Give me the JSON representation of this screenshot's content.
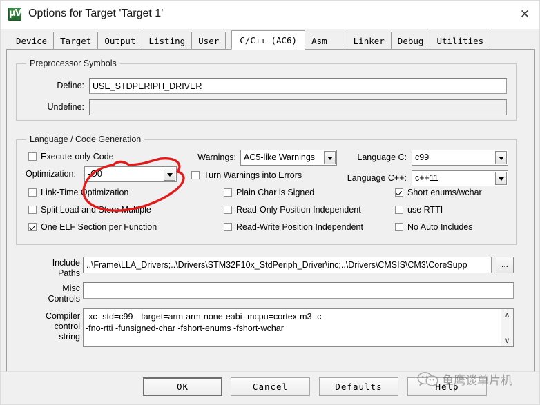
{
  "window": {
    "title": "Options for Target 'Target 1'",
    "app_icon": "keil-uvision-icon",
    "icon_glyph": "μV",
    "close_glyph": "✕"
  },
  "tabs": [
    {
      "label": "Device",
      "active": false
    },
    {
      "label": "Target",
      "active": false
    },
    {
      "label": "Output",
      "active": false
    },
    {
      "label": "Listing",
      "active": false
    },
    {
      "label": "User",
      "active": false
    },
    {
      "label": "C/C++ (AC6)",
      "active": true
    },
    {
      "label": "Asm",
      "active": false
    },
    {
      "label": "Linker",
      "active": false
    },
    {
      "label": "Debug",
      "active": false
    },
    {
      "label": "Utilities",
      "active": false
    }
  ],
  "preprocessor": {
    "title": "Preprocessor Symbols",
    "define_label": "Define:",
    "define_value": "USE_STDPERIPH_DRIVER",
    "undefine_label": "Undefine:",
    "undefine_value": ""
  },
  "language": {
    "title": "Language / Code Generation",
    "execute_only_code": {
      "label": "Execute-only Code",
      "checked": false
    },
    "optimization_label": "Optimization:",
    "optimization_value": "-O0",
    "link_time_optimization": {
      "label": "Link-Time Optimization",
      "checked": false
    },
    "split_load_store": {
      "label": "Split Load and Store Multiple",
      "checked": false
    },
    "one_elf_section": {
      "label": "One ELF Section per Function",
      "checked": true
    },
    "warnings_label": "Warnings:",
    "warnings_value": "AC5-like Warnings",
    "turn_warnings_into_errors": {
      "label": "Turn Warnings into Errors",
      "checked": false
    },
    "plain_char_signed": {
      "label": "Plain Char is Signed",
      "checked": false
    },
    "read_only_position_independent": {
      "label": "Read-Only Position Independent",
      "checked": false
    },
    "read_write_position_independent": {
      "label": "Read-Write Position Independent",
      "checked": false
    },
    "language_c_label": "Language C:",
    "language_c_value": "c99",
    "language_cpp_label": "Language C++:",
    "language_cpp_value": "c++11",
    "short_enums_wchar": {
      "label": "Short enums/wchar",
      "checked": true
    },
    "use_rtti": {
      "label": "use RTTI",
      "checked": false
    },
    "no_auto_includes": {
      "label": "No Auto Includes",
      "checked": false
    }
  },
  "paths": {
    "include_label_line1": "Include",
    "include_label_line2": "Paths",
    "include_value": "..\\Frame\\LLA_Drivers;..\\Drivers\\STM32F10x_StdPeriph_Driver\\inc;..\\Drivers\\CMSIS\\CM3\\CoreSupp",
    "browse_label": "...",
    "misc_label_line1": "Misc",
    "misc_label_line2": "Controls",
    "misc_value": "",
    "compiler_label_line1": "Compiler",
    "compiler_label_line2": "control",
    "compiler_label_line3": "string",
    "compiler_value_line1": "-xc -std=c99 --target=arm-arm-none-eabi -mcpu=cortex-m3 -c",
    "compiler_value_line2": "-fno-rtti -funsigned-char -fshort-enums -fshort-wchar",
    "scroll_up_glyph": "∧",
    "scroll_down_glyph": "∨"
  },
  "buttons": {
    "ok": "OK",
    "cancel": "Cancel",
    "defaults": "Defaults",
    "help": "Help"
  },
  "annotation": {
    "color": "#e01b1b",
    "shape": "hand-drawn-ellipse-around-optimization"
  },
  "watermark": {
    "text": "鱼鹰谈单片机",
    "icon": "wechat-icon"
  }
}
